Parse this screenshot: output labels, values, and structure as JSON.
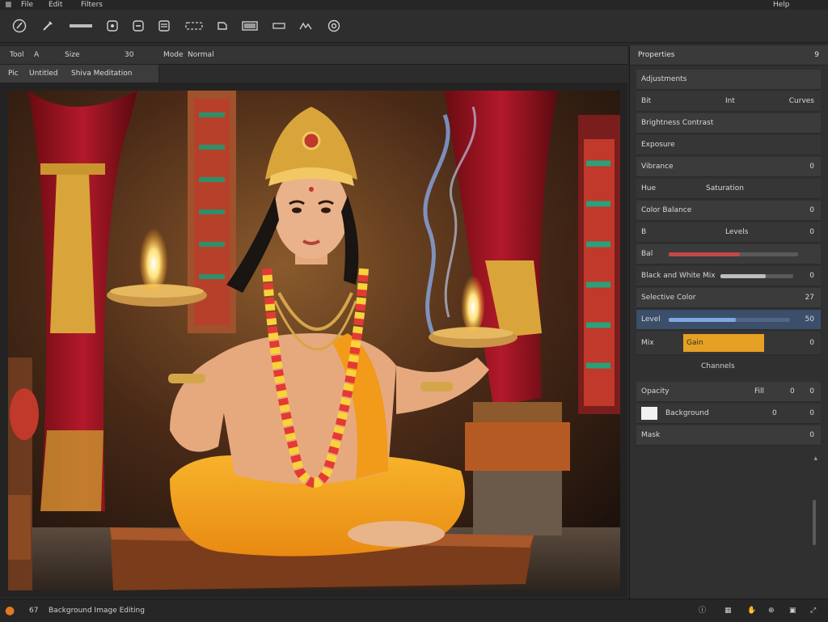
{
  "menubar": {
    "items": [
      "File",
      "Edit",
      "Filters"
    ],
    "right": "Help"
  },
  "toolbar": {
    "tools": [
      {
        "name": "brush-tool-icon"
      },
      {
        "name": "eyedropper-icon"
      },
      {
        "name": "text-tool-icon"
      },
      {
        "name": "crop-icon"
      },
      {
        "name": "stamp-icon"
      },
      {
        "name": "layers-icon"
      },
      {
        "name": "selection-icon"
      },
      {
        "name": "move-icon"
      },
      {
        "name": "rectangle-icon"
      },
      {
        "name": "line-icon"
      },
      {
        "name": "grid-icon"
      },
      {
        "name": "settings-icon"
      }
    ]
  },
  "options": {
    "items": [
      "Tool",
      "A",
      "Size",
      "30",
      "Mode",
      "Normal"
    ]
  },
  "tab": {
    "id": "Pic",
    "name": "Untitled",
    "label": "Shiva Meditation"
  },
  "panel": {
    "title": "Properties",
    "badge": "9",
    "rows": [
      {
        "label": "Adjustments",
        "right": ""
      },
      {
        "label": "Bit",
        "mid": "Int",
        "right": "Curves"
      },
      {
        "label": "Brightness Contrast",
        "right": ""
      },
      {
        "label": "Exposure",
        "right": ""
      },
      {
        "label": "Vibrance",
        "right": "0"
      },
      {
        "label": "Hue",
        "mid": "Saturation",
        "right": ""
      },
      {
        "label": "Color Balance",
        "right": "0"
      },
      {
        "label": "B",
        "mid": "Levels",
        "right": "0"
      },
      {
        "label": "Bal",
        "right": ""
      },
      {
        "label": "Black and White Mix",
        "right": "0"
      },
      {
        "label": "Selective Color",
        "right": "27"
      },
      {
        "label": "Level",
        "right": "50"
      },
      {
        "label": "Mix",
        "mid": "Gain",
        "right": "0"
      }
    ],
    "footer_label": "Channels",
    "layers_head": {
      "label": "Opacity",
      "mid": "Fill",
      "r1": "0",
      "r2": "0"
    },
    "layer": {
      "name": "Background",
      "v1": "0",
      "v2": "0"
    },
    "layer2": {
      "name": "Mask",
      "v": "0"
    },
    "levels": {
      "slider1": 0.55,
      "slider2": 0.62,
      "slider3": 0.55
    },
    "accent": "#e6a124",
    "selected": "#3b4f6a"
  },
  "status": {
    "zoom": "67",
    "text": "Background Image Editing",
    "icons": [
      "info-icon",
      "grid-icon",
      "hand-icon",
      "zoom-icon",
      "fit-icon"
    ]
  }
}
